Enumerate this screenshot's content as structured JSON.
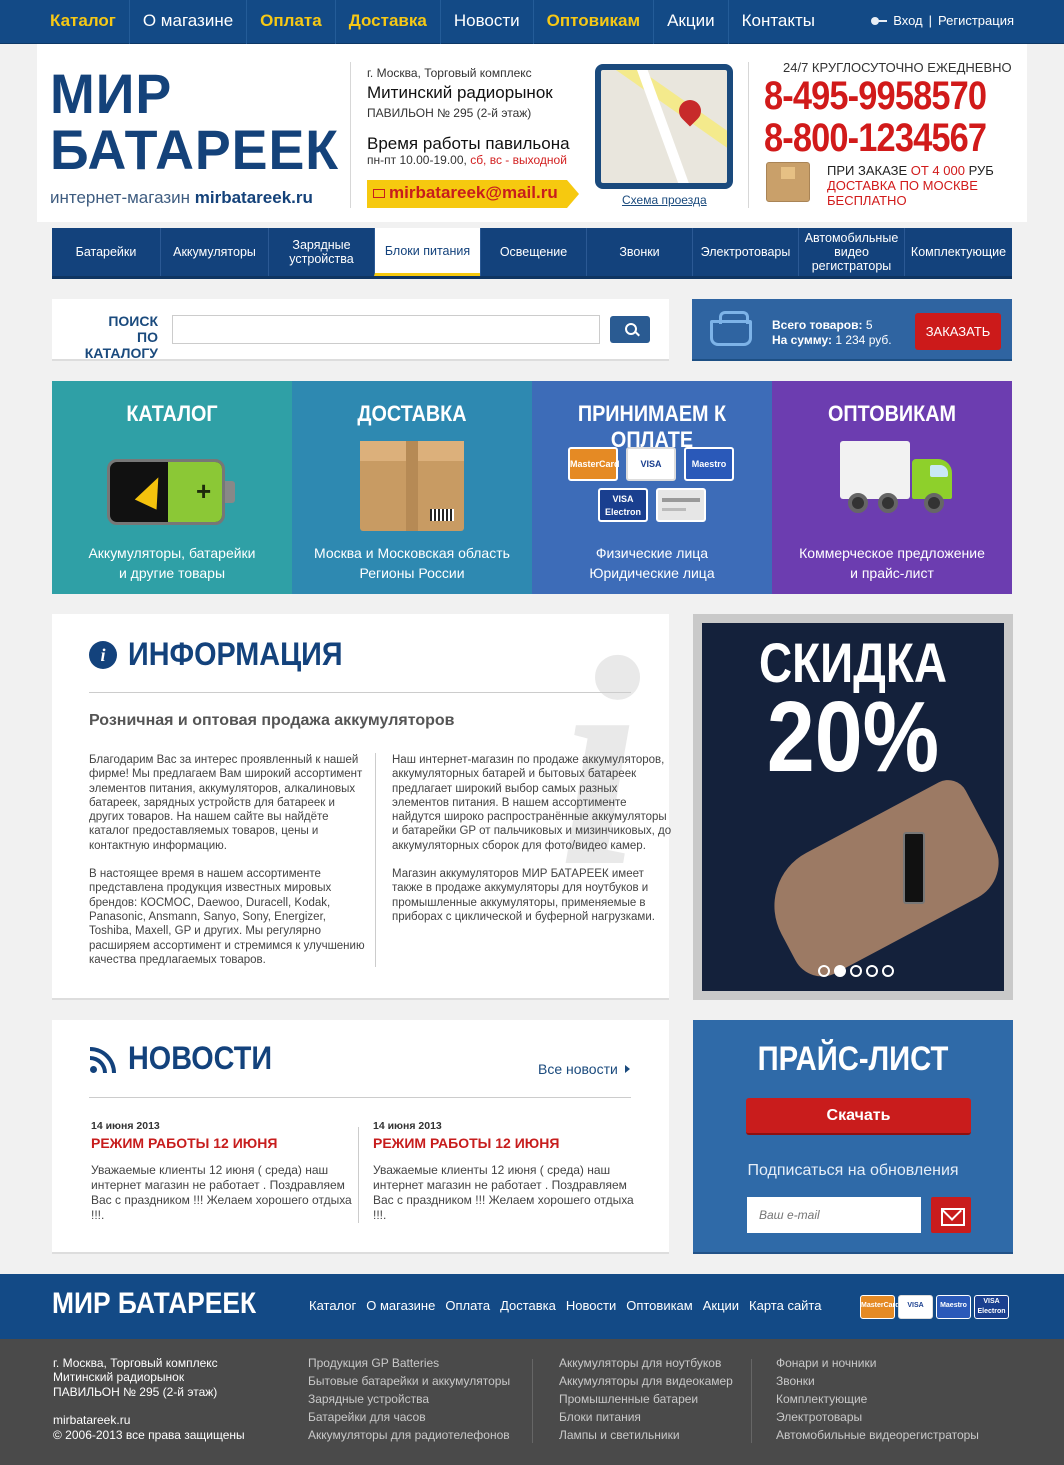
{
  "top_nav": {
    "items": [
      {
        "label": "Каталог",
        "highlight": true
      },
      {
        "label": "О магазине",
        "highlight": false
      },
      {
        "label": "Оплата",
        "highlight": true
      },
      {
        "label": "Доставка",
        "highlight": true
      },
      {
        "label": "Новости",
        "highlight": false
      },
      {
        "label": "Оптовикам",
        "highlight": true
      },
      {
        "label": "Акции",
        "highlight": false
      },
      {
        "label": "Контакты",
        "highlight": false
      }
    ],
    "login": "Вход",
    "separator": "|",
    "register": "Регистрация"
  },
  "header": {
    "logo_line1": "МИР",
    "logo_line2": "БАТАРЕЕК",
    "logo_sub_prefix": "интернет-магазин",
    "logo_sub_domain": "mirbatareek.ru",
    "address_line1": "г. Москва, Торговый комплекс",
    "address_line2": "Митинский радиорынок",
    "address_line3": "ПАВИЛЬОН № 295 (2-й этаж)",
    "hours_title": "Время работы павильона",
    "hours_weekdays": "пн-пт 10.00-19.00,",
    "hours_weekend": "сб, вс - выходной",
    "email": "mirbatareek@mail.ru",
    "map_link": "Схема проезда",
    "hours_247": "24/7 КРУГЛОСУТОЧНО ЕЖЕДНЕВНО",
    "phone1": "8-495-9958570",
    "phone2": "8-800-1234567",
    "promo_line1_prefix": "ПРИ ЗАКАЗЕ",
    "promo_line1_amount": "ОТ 4 000",
    "promo_line1_suffix": "РУБ",
    "promo_line2": "ДОСТАВКА ПО МОСКВЕ",
    "promo_line3": "БЕСПЛАТНО"
  },
  "category_nav": {
    "items": [
      {
        "label": "Батарейки",
        "active": false
      },
      {
        "label": "Аккумуляторы",
        "active": false
      },
      {
        "label": "Зарядные устройства",
        "active": false
      },
      {
        "label": "Блоки питания",
        "active": true
      },
      {
        "label": "Освещение",
        "active": false
      },
      {
        "label": "Звонки",
        "active": false
      },
      {
        "label": "Электротовары",
        "active": false
      },
      {
        "label": "Автомобильные видео регистраторы",
        "active": false
      },
      {
        "label": "Комплектующие",
        "active": false
      }
    ]
  },
  "search": {
    "label_line1": "ПОИСК",
    "label_line2": "ПО КАТАЛОГУ",
    "value": "",
    "button_icon": "search-icon"
  },
  "cart": {
    "total_items_label": "Всего товаров:",
    "total_items": "5",
    "total_sum_label": "На сумму:",
    "total_sum": "1 234 руб.",
    "order_button": "ЗАКАЗАТЬ"
  },
  "tiles": [
    {
      "title": "КАТАЛОГ",
      "line1": "Аккумуляторы, батарейки",
      "line2": "и другие товары",
      "color": "#2fa0a6"
    },
    {
      "title": "ДОСТАВКА",
      "line1": "Москва и Московская область",
      "line2": "Регионы России",
      "color": "#2e89b1"
    },
    {
      "title": "ПРИНИМАЕМ К ОПЛАТЕ",
      "line1": "Физические лица",
      "line2": "Юридические лица",
      "color": "#3d6cb8",
      "cards": [
        "MasterCard",
        "VISA",
        "Maestro",
        "VISA Electron"
      ]
    },
    {
      "title": "ОПТОВИКАМ",
      "line1": "Коммерческое предложение",
      "line2": "и прайс-лист",
      "color": "#6c3db0"
    }
  ],
  "info": {
    "title": "ИНФОРМАЦИЯ",
    "subtitle": "Розничная и оптовая продажа аккумуляторов",
    "col1_p1": "Благодарим Вас за интерес проявленный к нашей фирме! Мы предлагаем Вам широкий ассортимент элементов питания, аккумуляторов, алкалиновых батареек, зарядных устройств для батареек и других товаров. На нашем сайте вы найдёте каталог предоставляемых товаров, цены и контактную информацию.",
    "col1_p2": "В настоящее время в нашем ассортименте представлена продукция известных мировых брендов: КОСМОС, Daewoo, Duracell, Kodak, Panasonic, Ansmann, Sanyo, Sony, Energizer, Toshiba, Maxell, GP и других. Мы регулярно расширяем ассортимент и стремимся к улучшению качества предлагаемых товаров.",
    "col2_p1": "Наш интернет-магазин по продаже аккумуляторов, аккумуляторных батарей и бытовых батареек предлагает широкий выбор самых разных элементов питания. В нашем ассортименте найдутся широко распространённые аккумуляторы и батарейки GP от пальчиковых и мизинчиковых, до аккумуляторных сборок для фото/видео камер.",
    "col2_p2": "Магазин аккумуляторов МИР БАТАРЕЕК имеет также в продаже аккумуляторы для ноутбуков и промышленные аккумуляторы, применяемые в приборах с циклической и буферной нагрузками."
  },
  "promo_slider": {
    "line1": "СКИДКА",
    "line2": "20%",
    "slides": 5,
    "active_slide": 2
  },
  "news": {
    "title": "НОВОСТИ",
    "all_link": "Все новости",
    "items": [
      {
        "date": "14 июня 2013",
        "headline": "РЕЖИМ РАБОТЫ 12 ИЮНЯ",
        "text": "Уважаемые клиенты 12 июня ( среда) наш интернет магазин не работает . Поздравляем Вас с праздником !!! Желаем хорошего отдыха !!!."
      },
      {
        "date": "14 июня 2013",
        "headline": "РЕЖИМ РАБОТЫ 12 ИЮНЯ",
        "text": "Уважаемые клиенты 12 июня ( среда) наш интернет магазин не работает . Поздравляем Вас с праздником !!! Желаем хорошего отдыха !!!."
      }
    ]
  },
  "price_list": {
    "title": "ПРАЙС-ЛИСТ",
    "download_button": "Скачать",
    "subscribe_label": "Подписаться на обновления",
    "email_placeholder": "Ваш e-mail"
  },
  "footer": {
    "logo": "МИР БАТАРЕЕК",
    "nav": [
      "Каталог",
      "О магазине",
      "Оплата",
      "Доставка",
      "Новости",
      "Оптовикам",
      "Акции",
      "Карта сайта"
    ],
    "cards": [
      "MasterCard",
      "VISA",
      "Maestro",
      "VISA Electron"
    ],
    "address_line1": "г. Москва, Торговый комплекс",
    "address_line2": "Митинский радиорынок",
    "address_line3": "ПАВИЛЬОН № 295 (2-й этаж)",
    "site": "mirbatareek.ru",
    "copyright": "© 2006-2013 все права защищены",
    "col1": [
      "Продукция GP Batteries",
      "Бытовые батарейки и аккумуляторы",
      "Зарядные устройства",
      "Батарейки для часов",
      "Аккумуляторы для радиотелефонов"
    ],
    "col2": [
      "Аккумуляторы для ноутбуков",
      "Аккумуляторы для видеокамер",
      "Промышленные батареи",
      "Блоки питания",
      "Лампы и светильники"
    ],
    "col3": [
      "Фонари и ночники",
      "Звонки",
      "Комплектующие",
      "Электротовары",
      "Автомобильные видеорегистраторы"
    ]
  }
}
